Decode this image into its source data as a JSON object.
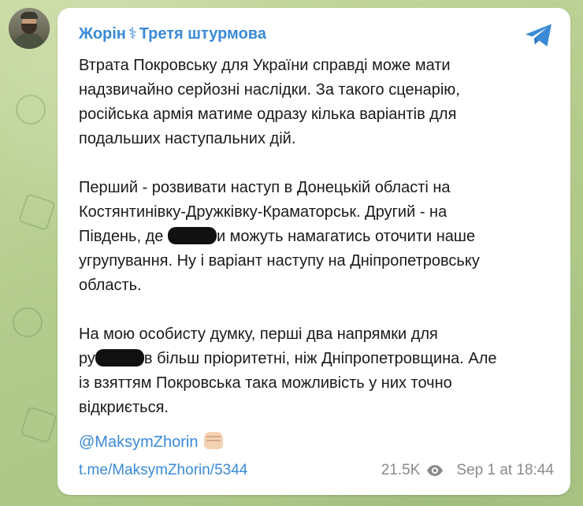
{
  "channel": {
    "name": "Жорін",
    "separator": "⚕",
    "subtitle": "Третя штурмова"
  },
  "message": {
    "paragraph1": "Втрата Покровську для України справді може мати\nнадзвичайно серйозні наслідки. За такого сценарію,\nросійська армія матиме одразу кілька варіантів для\nподальших наступальних дій.",
    "paragraph2_part1": "Перший - розвивати наступ в Донецькій області на\nКостянтинівку-Дружківку-Краматорськ. Другий - на\nПівдень, де ",
    "paragraph2_part2": "и можуть намагатись оточити наше\nугрупування. Ну і варіант наступу на Дніпропетровську\nобласть.",
    "paragraph3_part1": "На мою особисту думку, перші два напрямки для\nру",
    "paragraph3_part2": "в більш пріоритетні, ніж Дніпропетровщина. Але\nіз взяттям Покровська така можливість у них точно\nвідкриється."
  },
  "footer": {
    "author_handle": "@MaksymZhorin",
    "post_link": "t.me/MaksymZhorin/5344",
    "views": "21.5K",
    "date": "Sep 1 at 18:44"
  },
  "colors": {
    "accent": "#3a8ad6",
    "meta": "#8a8a8a",
    "text": "#1a1a1a"
  },
  "icons": {
    "app": "telegram-icon",
    "views": "eye-icon",
    "reaction": "fist-emoji-icon"
  }
}
